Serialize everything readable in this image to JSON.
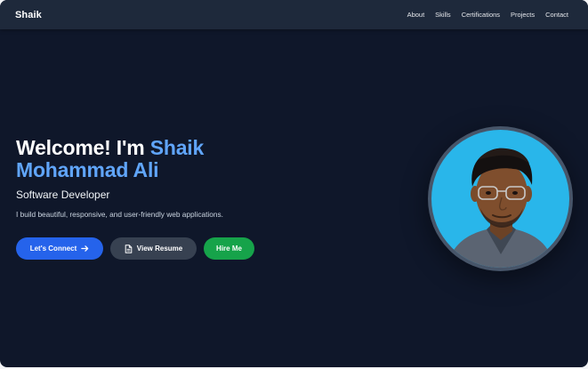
{
  "nav": {
    "brand": "Shaik",
    "links": [
      "About",
      "Skills",
      "Certifications",
      "Projects",
      "Contact"
    ]
  },
  "hero": {
    "greeting": "Welcome! I'm ",
    "first_name": "Shaik",
    "last_name": "Mohammad Ali",
    "role": "Software Developer",
    "tagline": "I build beautiful, responsive, and user-friendly web applications."
  },
  "buttons": {
    "connect": "Let's Connect",
    "resume": "View Resume",
    "hire": "Hire Me"
  },
  "icons": {
    "connect": "arrow-right-icon",
    "resume": "document-icon",
    "avatar": "profile-photo"
  },
  "colors": {
    "background": "#0f172a",
    "navbar": "#1e293b",
    "accent": "#60a5fa",
    "primary_button": "#2563eb",
    "secondary_button": "#374151",
    "success_button": "#16a34a",
    "avatar_background": "#29b6ea"
  }
}
